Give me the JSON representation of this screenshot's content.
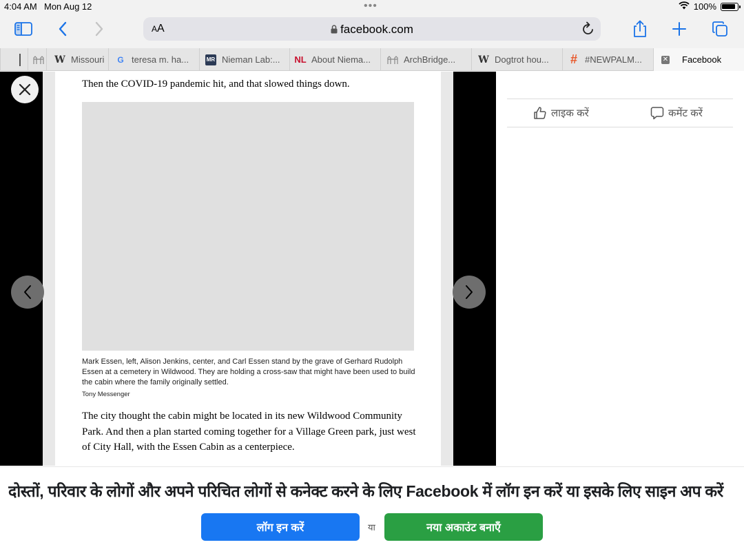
{
  "status_bar": {
    "time": "4:04 AM",
    "date": "Mon Aug 12",
    "battery": "100%",
    "dots": "•••"
  },
  "toolbar": {
    "text_size_label": "AA",
    "url": "facebook.com",
    "accent_color": "#1a73e8"
  },
  "tabs": [
    {
      "label": "",
      "icon": "bridge-favicon"
    },
    {
      "label": "Missouri",
      "icon": "wikipedia-favicon"
    },
    {
      "label": "teresa m. ha...",
      "icon": "google-favicon"
    },
    {
      "label": "Nieman Lab:...",
      "icon": "mr-favicon"
    },
    {
      "label": "About Niema...",
      "icon": "nl-favicon"
    },
    {
      "label": "ArchBridge...",
      "icon": "bridge-favicon"
    },
    {
      "label": "Dogtrot hou...",
      "icon": "wikipedia-favicon"
    },
    {
      "label": "#NEWPALM...",
      "icon": "hashtag-favicon"
    },
    {
      "label": "Facebook",
      "icon": "close-tab-icon",
      "active": true
    }
  ],
  "article": {
    "line1": "Then the COVID-19 pandemic hit, and that slowed things down.",
    "caption": "Mark Essen, left, Alison Jenkins, center, and Carl Essen stand by the grave of Gerhard Rudolph Essen at a cemetery in Wildwood. They are holding a cross-saw that might have been used to build the cabin where the family originally settled.",
    "credit": "Tony Messenger",
    "paragraph": "The city thought the cabin might be located in its new Wildwood Community Park. And then a plan started coming together for a Village Green park, just west of City Hall, with the Essen Cabin as a centerpiece."
  },
  "actions": {
    "like": "लाइक करें",
    "comment": "कमेंट करें"
  },
  "banner": {
    "text": "दोस्तों, परिवार के लोगों और अपने परिचित लोगों से कनेक्ट करने के लिए Facebook में लॉग इन करें या इसके लिए साइन अप करें",
    "login": "लॉग इन करें",
    "or": "या",
    "signup": "नया अकाउंट बनाएँ",
    "login_color": "#1877f2",
    "signup_color": "#2a9f43"
  }
}
